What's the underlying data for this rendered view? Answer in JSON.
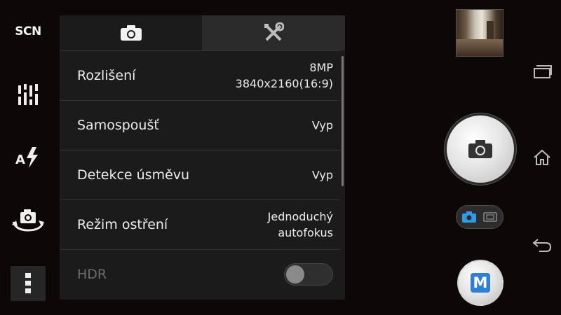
{
  "left_bar": {
    "scn_label": "SCN",
    "items": [
      {
        "icon": "scene-icon"
      },
      {
        "icon": "sliders-icon"
      },
      {
        "icon": "auto-flash-icon"
      },
      {
        "icon": "switch-camera-icon"
      },
      {
        "icon": "more-icon"
      }
    ]
  },
  "settings_panel": {
    "tabs": [
      {
        "icon": "camera-icon",
        "selected": true
      },
      {
        "icon": "wrench-screwdriver-icon",
        "selected": false
      }
    ],
    "rows": [
      {
        "label": "Rozlišení",
        "value_line1": "8MP",
        "value_line2": "3840x2160(16:9)"
      },
      {
        "label": "Samospoušť",
        "value": "Vyp"
      },
      {
        "label": "Detekce úsměvu",
        "value": "Vyp"
      },
      {
        "label": "Režim ostření",
        "value_line1": "Jednoduchý",
        "value_line2": "autofokus"
      },
      {
        "label": "HDR",
        "toggle_on": false,
        "disabled": true
      }
    ]
  },
  "right_controls": {
    "manual_label": "M",
    "mode_selected": "photo"
  },
  "colors": {
    "accent_blue": "#2f7fd6",
    "panel_bg": "#1b1b1b",
    "background": "#0d0708"
  },
  "nav_buttons": [
    "recent-apps-icon",
    "home-icon",
    "back-icon"
  ]
}
